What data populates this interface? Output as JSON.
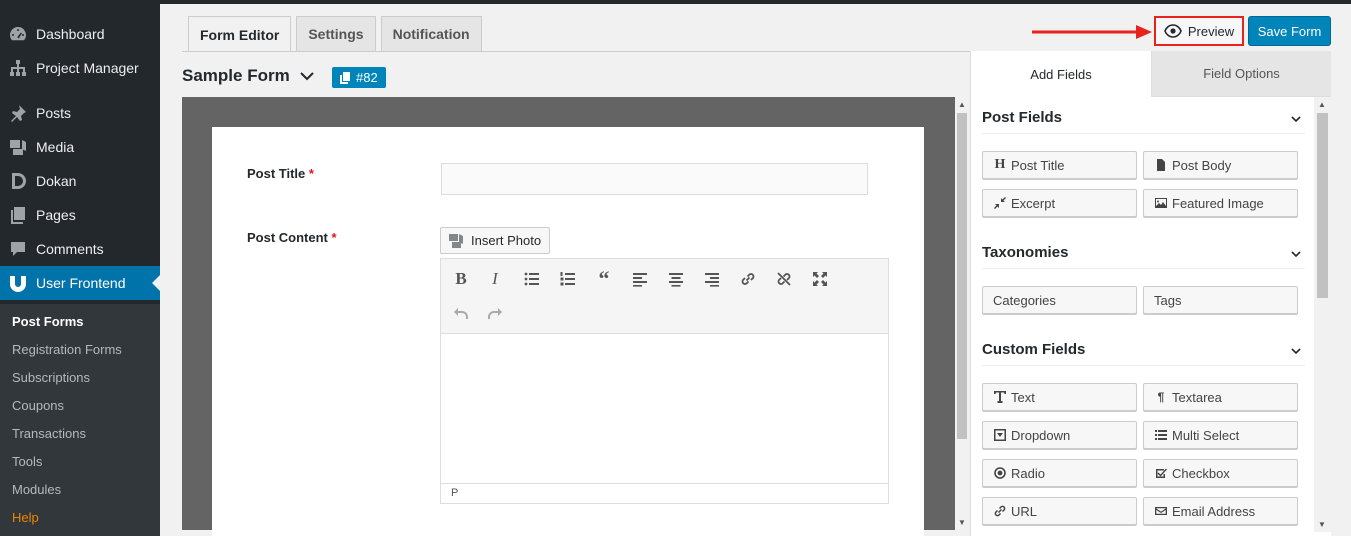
{
  "sidebar": {
    "items": [
      {
        "label": "Dashboard",
        "icon": "dashboard-icon"
      },
      {
        "label": "Project Manager",
        "icon": "sitemap-icon"
      },
      {
        "label": "Posts",
        "icon": "pin-icon"
      },
      {
        "label": "Media",
        "icon": "media-icon"
      },
      {
        "label": "Dokan",
        "icon": "dokan-icon"
      },
      {
        "label": "Pages",
        "icon": "pages-icon"
      },
      {
        "label": "Comments",
        "icon": "comment-icon"
      },
      {
        "label": "User Frontend",
        "icon": "user-frontend-icon"
      }
    ],
    "submenu": [
      "Post Forms",
      "Registration Forms",
      "Subscriptions",
      "Coupons",
      "Transactions",
      "Tools",
      "Modules",
      "Help"
    ],
    "accent": "#0073aa",
    "help_color": "#f18500"
  },
  "tabs": [
    "Form Editor",
    "Settings",
    "Notification"
  ],
  "form": {
    "title": "Sample Form",
    "id_badge": "#82"
  },
  "toolbar": {
    "preview_label": "Preview",
    "save_label": "Save Form"
  },
  "editor": {
    "fields": [
      {
        "label": "Post Title",
        "required": "*"
      },
      {
        "label": "Post Content",
        "required": "*"
      }
    ],
    "insert_photo_label": "Insert Photo",
    "status_path": "P"
  },
  "panel": {
    "tabs": [
      "Add Fields",
      "Field Options"
    ],
    "sections": [
      {
        "title": "Post Fields",
        "buttons": [
          {
            "label": "Post Title",
            "icon": "heading-icon"
          },
          {
            "label": "Post Body",
            "icon": "file-icon"
          },
          {
            "label": "Excerpt",
            "icon": "compress-icon"
          },
          {
            "label": "Featured Image",
            "icon": "image-icon"
          }
        ]
      },
      {
        "title": "Taxonomies",
        "buttons": [
          {
            "label": "Categories",
            "icon": ""
          },
          {
            "label": "Tags",
            "icon": ""
          }
        ]
      },
      {
        "title": "Custom Fields",
        "buttons": [
          {
            "label": "Text",
            "icon": "text-icon"
          },
          {
            "label": "Textarea",
            "icon": "paragraph-icon"
          },
          {
            "label": "Dropdown",
            "icon": "dropdown-icon"
          },
          {
            "label": "Multi Select",
            "icon": "list-icon"
          },
          {
            "label": "Radio",
            "icon": "radio-icon"
          },
          {
            "label": "Checkbox",
            "icon": "checkbox-icon"
          },
          {
            "label": "URL",
            "icon": "link-icon"
          },
          {
            "label": "Email Address",
            "icon": "envelope-icon"
          }
        ]
      }
    ]
  },
  "colors": {
    "primary": "#0085ba",
    "highlight": "#e8231e"
  }
}
